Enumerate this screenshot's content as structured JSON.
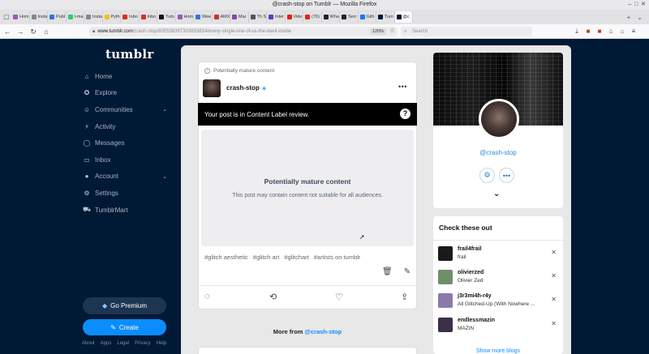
{
  "window": {
    "title": "@crash-stop on Tumblr — Mozilla Firefox"
  },
  "tabs": [
    {
      "label": "Hom",
      "color": "#9b59b6"
    },
    {
      "label": "Install",
      "color": "#888888"
    },
    {
      "label": "Publ",
      "color": "#3a6fd8"
    },
    {
      "label": "I-ma",
      "color": "#2ecc71"
    },
    {
      "label": "Install",
      "color": "#888888"
    },
    {
      "label": "Pyth",
      "color": "#f1c40f"
    },
    {
      "label": "Inbo",
      "color": "#d93025"
    },
    {
      "label": "Inbo",
      "color": "#d93025"
    },
    {
      "label": "Tuto",
      "color": "#111111"
    },
    {
      "label": "Hom",
      "color": "#9b59b6"
    },
    {
      "label": "Wee",
      "color": "#3a6fd8"
    },
    {
      "label": "AMX",
      "color": "#c0392b"
    },
    {
      "label": "Mar",
      "color": "#8e44ad"
    },
    {
      "label": "Th Sc",
      "color": "#555555"
    },
    {
      "label": "Inter",
      "color": "#5b3cc4"
    },
    {
      "label": "Vide",
      "color": "#e62117"
    },
    {
      "label": "(76)",
      "color": "#e62117"
    },
    {
      "label": "Wha",
      "color": "#222222"
    },
    {
      "label": "Serr",
      "color": "#222222"
    },
    {
      "label": "Gith",
      "color": "#1877f2"
    },
    {
      "label": "Tum",
      "color": "#001935"
    },
    {
      "label": "@c",
      "color": "#001935",
      "active": true
    }
  ],
  "url": {
    "host": "www.tumblr.com",
    "path": "/crash-stop/80553839730385382​4/every-single-one-of-us-the-devil-inside"
  },
  "zoom": "120%",
  "search": {
    "placeholder": "Search"
  },
  "brand": {
    "logo": "tumblr"
  },
  "menu": [
    {
      "label": "Home",
      "icon": "home-icon",
      "glyph": "⌂"
    },
    {
      "label": "Explore",
      "icon": "compass-icon",
      "glyph": "✪"
    },
    {
      "label": "Communities",
      "icon": "communities-icon",
      "glyph": "☺",
      "chevron": true
    },
    {
      "label": "Activity",
      "icon": "bolt-icon",
      "glyph": "⚡"
    },
    {
      "label": "Messages",
      "icon": "chat-icon",
      "glyph": "◯"
    },
    {
      "label": "Inbox",
      "icon": "inbox-icon",
      "glyph": "▭"
    },
    {
      "label": "Account",
      "icon": "account-icon",
      "glyph": "●",
      "chevron": true
    },
    {
      "label": "Settings",
      "icon": "gear-icon",
      "glyph": "⚙"
    },
    {
      "label": "TumblrMart",
      "icon": "mart-icon",
      "glyph": "⛟"
    }
  ],
  "premium_label": "Go Premium",
  "create_label": "Create",
  "footer_links": [
    "About",
    "Apps",
    "Legal",
    "Privacy",
    "Help"
  ],
  "post": {
    "notice": "Potentially mature content",
    "username": "crash-stop",
    "review_banner": "Your post is in Content Label review.",
    "mature_title": "Potentially mature content",
    "mature_subtitle": "This post may contain content not suitable for all audiences.",
    "tags": [
      "#glitch aesthetic",
      "#glitch art",
      "#glitchart",
      "#artists on tumblr"
    ]
  },
  "more_from": {
    "prefix": "More from ",
    "blog": "@crash-stop"
  },
  "blog": {
    "name": "@crash-stop"
  },
  "recs": {
    "title": "Check these out",
    "items": [
      {
        "name": "frail4frail",
        "desc": "frail",
        "color": "#1a1a1a"
      },
      {
        "name": "olivierzed",
        "desc": "Olivier Zed",
        "color": "#6f8f6a"
      },
      {
        "name": "j3r3mi4h-r4y",
        "desc": "All Glitched-Up (With Nowhere ...",
        "color": "#8a7aa8"
      },
      {
        "name": "endlessmazin",
        "desc": "MAZIN",
        "color": "#3b3046"
      }
    ],
    "show_more": "Show more blogs"
  }
}
